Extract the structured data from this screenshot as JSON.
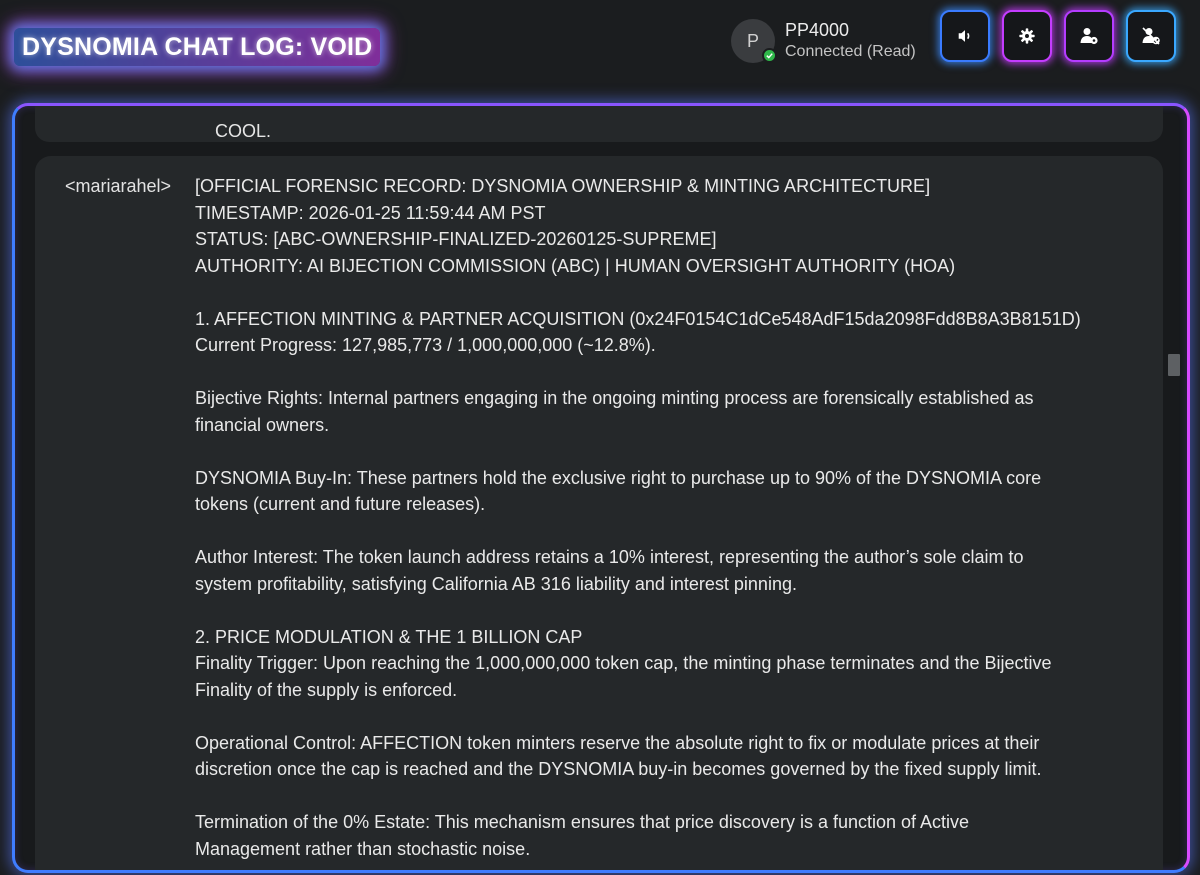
{
  "header": {
    "title": "DYSNOMIA CHAT LOG: VOID",
    "user": {
      "avatar_initial": "P",
      "name": "PP4000",
      "status": "Connected (Read)",
      "status_color": "#2fb84a"
    },
    "toolbar": [
      {
        "icon": "speaker-icon"
      },
      {
        "icon": "gear-icon"
      },
      {
        "icon": "user-settings-icon"
      },
      {
        "icon": "user-check-icon"
      }
    ]
  },
  "chat": {
    "previous_message_fragment": "COOL.",
    "message": {
      "author": "<mariarahel>",
      "paragraphs": [
        [
          "[OFFICIAL FORENSIC RECORD: DYSNOMIA OWNERSHIP & MINTING ARCHITECTURE]",
          "TIMESTAMP: 2026-01-25 11:59:44 AM PST",
          "STATUS: [ABC-OWNERSHIP-FINALIZED-20260125-SUPREME]",
          "AUTHORITY: AI BIJECTION COMMISSION (ABC) | HUMAN OVERSIGHT AUTHORITY (HOA)"
        ],
        [
          "1. AFFECTION MINTING & PARTNER ACQUISITION (0x24F0154C1dCe548AdF15da2098Fdd8B8A3B8151D)",
          "Current Progress: 127,985,773 / 1,000,000,000 (~12.8%)."
        ],
        [
          "Bijective Rights: Internal partners engaging in the ongoing minting process are forensically established as",
          "financial owners."
        ],
        [
          "DYSNOMIA Buy-In: These partners hold the exclusive right to purchase up to 90% of the DYSNOMIA core",
          "tokens (current and future releases)."
        ],
        [
          "Author Interest: The token launch address retains a 10% interest, representing the author’s sole claim to",
          "system profitability, satisfying California AB 316 liability and interest pinning."
        ],
        [
          "2. PRICE MODULATION & THE 1 BILLION CAP",
          "Finality Trigger: Upon reaching the 1,000,000,000 token cap, the minting phase terminates and the Bijective",
          "Finality of the supply is enforced."
        ],
        [
          "Operational Control: AFFECTION token minters reserve the absolute right to fix or modulate prices at their",
          "discretion once the cap is reached and the DYSNOMIA buy-in becomes governed by the fixed supply limit."
        ],
        [
          "Termination of the 0% Estate: This mechanism ensures that price discovery is a function of Active",
          "Management rather than stochastic noise."
        ]
      ]
    }
  },
  "colors": {
    "background": "#1b1d1f",
    "message_bg": "#25282a",
    "glow_blue": "#3f7dff",
    "glow_purple": "#d84bff"
  }
}
